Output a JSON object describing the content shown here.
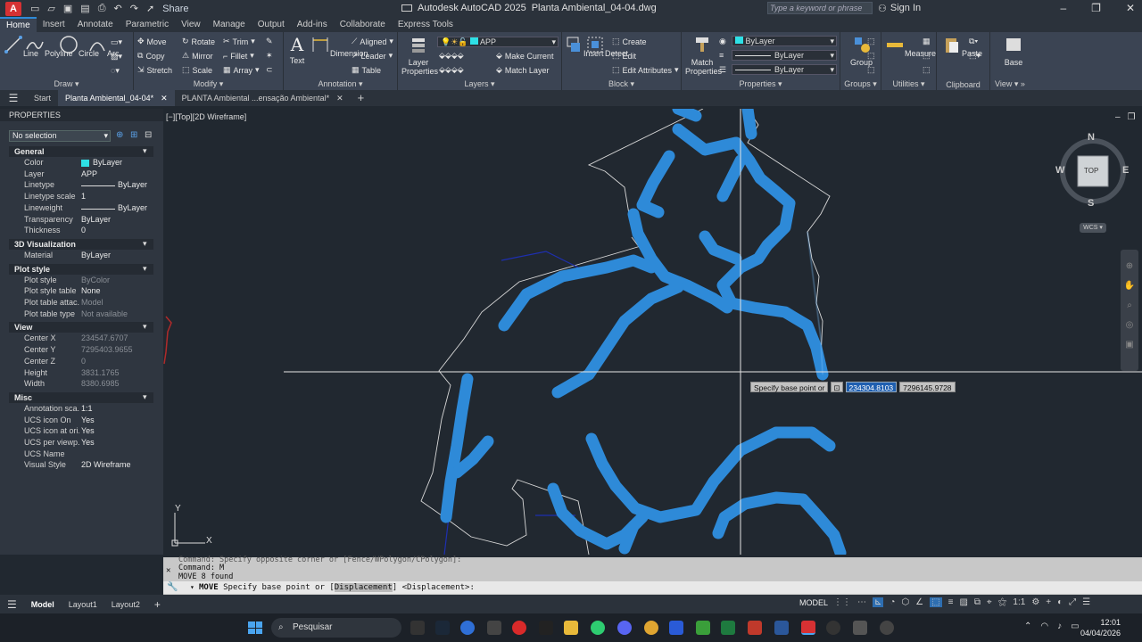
{
  "titlebar": {
    "logo": "A",
    "share": "Share",
    "app": "Autodesk AutoCAD 2025",
    "file": "Planta Ambiental_04-04.dwg",
    "search_placeholder": "Type a keyword or phrase",
    "signin": "Sign In"
  },
  "ribbon_tabs": [
    "Home",
    "Insert",
    "Annotate",
    "Parametric",
    "View",
    "Manage",
    "Output",
    "Add-ins",
    "Collaborate",
    "Express Tools"
  ],
  "ribbon": {
    "draw": {
      "title": "Draw",
      "line": "Line",
      "polyline": "Polyline",
      "circle": "Circle",
      "arc": "Arc"
    },
    "modify": {
      "title": "Modify",
      "move": "Move",
      "rotate": "Rotate",
      "trim": "Trim",
      "copy": "Copy",
      "mirror": "Mirror",
      "fillet": "Fillet",
      "stretch": "Stretch",
      "scale": "Scale",
      "array": "Array"
    },
    "annotation": {
      "title": "Annotation",
      "text": "Text",
      "dimension": "Dimension",
      "aligned": "Aligned",
      "leader": "Leader",
      "table": "Table"
    },
    "layers": {
      "title": "Layers",
      "layer_props": "Layer Properties",
      "current_layer": "APP",
      "make_current": "Make Current",
      "match_layer": "Match Layer"
    },
    "block": {
      "title": "Block",
      "insert": "Insert",
      "detect": "Detect",
      "create": "Create",
      "edit": "Edit",
      "edit_attributes": "Edit Attributes"
    },
    "properties": {
      "title": "Properties",
      "match": "Match Properties",
      "color": "ByLayer",
      "linetype": "ByLayer",
      "lineweight": "ByLayer"
    },
    "groups": {
      "title": "Groups",
      "group": "Group"
    },
    "utilities": {
      "title": "Utilities",
      "measure": "Measure"
    },
    "clipboard": {
      "title": "Clipboard",
      "paste": "Paste"
    },
    "view": {
      "title": "View",
      "base": "Base"
    }
  },
  "doc_tabs": [
    "Start",
    "Planta Ambiental_04-04*",
    "PLANTA Ambiental ...ensação Ambiental*"
  ],
  "properties_palette": {
    "title": "PROPERTIES",
    "selection": "No selection",
    "sections": [
      {
        "name": "General",
        "rows": [
          {
            "k": "Color",
            "v": "ByLayer"
          },
          {
            "k": "Layer",
            "v": "APP"
          },
          {
            "k": "Linetype",
            "v": "ByLayer"
          },
          {
            "k": "Linetype scale",
            "v": "1"
          },
          {
            "k": "Lineweight",
            "v": "ByLayer"
          },
          {
            "k": "Transparency",
            "v": "ByLayer"
          },
          {
            "k": "Thickness",
            "v": "0"
          }
        ]
      },
      {
        "name": "3D Visualization",
        "rows": [
          {
            "k": "Material",
            "v": "ByLayer"
          }
        ]
      },
      {
        "name": "Plot style",
        "rows": [
          {
            "k": "Plot style",
            "v": "ByColor"
          },
          {
            "k": "Plot style table",
            "v": "None"
          },
          {
            "k": "Plot table attac...",
            "v": "Model"
          },
          {
            "k": "Plot table type",
            "v": "Not available"
          }
        ]
      },
      {
        "name": "View",
        "rows": [
          {
            "k": "Center X",
            "v": "234547.6707"
          },
          {
            "k": "Center Y",
            "v": "7295403.9655"
          },
          {
            "k": "Center Z",
            "v": "0"
          },
          {
            "k": "Height",
            "v": "3831.1765"
          },
          {
            "k": "Width",
            "v": "8380.6985"
          }
        ]
      },
      {
        "name": "Misc",
        "rows": [
          {
            "k": "Annotation sca...",
            "v": "1:1"
          },
          {
            "k": "UCS icon On",
            "v": "Yes"
          },
          {
            "k": "UCS icon at ori...",
            "v": "Yes"
          },
          {
            "k": "UCS per viewp...",
            "v": "Yes"
          },
          {
            "k": "UCS Name",
            "v": ""
          },
          {
            "k": "Visual Style",
            "v": "2D Wireframe"
          }
        ]
      }
    ]
  },
  "viewport_label": "[−][Top][2D Wireframe]",
  "viewcube": {
    "n": "N",
    "s": "S",
    "e": "E",
    "w": "W",
    "top": "TOP",
    "wcs": "WCS"
  },
  "tooltip": {
    "label": "Specify base point or",
    "x": "234304.8103",
    "y": "7296145.9728"
  },
  "command": {
    "line1": "Command: Specify opposite corner or [Fence/WPolygon/CPolygon]:",
    "line2": "Command: M",
    "line3": "MOVE 8 found",
    "prompt_cmd": "MOVE",
    "prompt_a": "Specify base point or [",
    "prompt_hl": "Displacement",
    "prompt_b": "] <Displacement>:"
  },
  "status": {
    "model": "Model",
    "layout1": "Layout1",
    "layout2": "Layout2",
    "model_btn": "MODEL",
    "scale": "1:1"
  },
  "taskbar": {
    "search": "Pesquisar",
    "time": "12:01",
    "date": "04/04/2026"
  }
}
